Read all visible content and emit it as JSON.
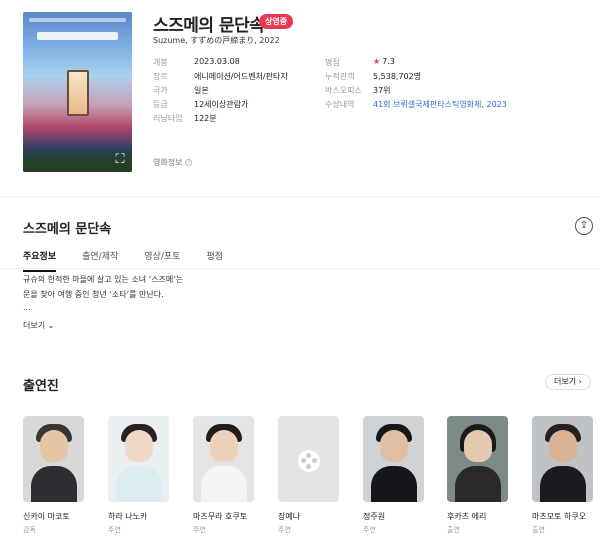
{
  "movie": {
    "title": "스즈메의 문단속",
    "badge": "상영중",
    "subtitle": "Suzume, すずめの戸締まり, 2022"
  },
  "details_left": [
    {
      "key": "개봉",
      "value": "2023.03.08"
    },
    {
      "key": "장르",
      "value": "애니메이션/어드벤처/판타지"
    },
    {
      "key": "국가",
      "value": "일본"
    },
    {
      "key": "등급",
      "value": "12세이상관람가"
    },
    {
      "key": "러닝타임",
      "value": "122분"
    }
  ],
  "details_right": [
    {
      "key": "평점",
      "value": "7.3"
    },
    {
      "key": "누적관객",
      "value": "5,538,702명"
    },
    {
      "key": "박스오피스",
      "value": "37위"
    },
    {
      "key": "수상내역",
      "value": "41회 브뤼셀국제판타스틱영화제, 2023"
    }
  ],
  "info_label": "영화정보",
  "section_title": "스즈메의 문단속",
  "tabs": [
    "주요정보",
    "출연/제작",
    "영상/포토",
    "평점"
  ],
  "synopsis": {
    "line1": "규슈의 한적한 마을에 살고 있는 소녀 ‘스즈메’는",
    "line2": "문을 찾아 여행 중인 청년 ‘소타’를 만난다.",
    "line3": "...",
    "more": "더보기"
  },
  "cast": {
    "title": "출연진",
    "more": "더보기",
    "members": [
      {
        "name": "신카이 마코토",
        "role": "감독"
      },
      {
        "name": "하라 나노카",
        "role": "주연"
      },
      {
        "name": "마츠무라 호쿠토",
        "role": "주연"
      },
      {
        "name": "장예나",
        "role": "주연"
      },
      {
        "name": "정주원",
        "role": "주연"
      },
      {
        "name": "후카츠 에리",
        "role": "출연"
      },
      {
        "name": "마츠모토 하쿠오",
        "role": "출연"
      }
    ]
  },
  "colors": {
    "accent": "#e8384f",
    "link": "#3369c7"
  }
}
